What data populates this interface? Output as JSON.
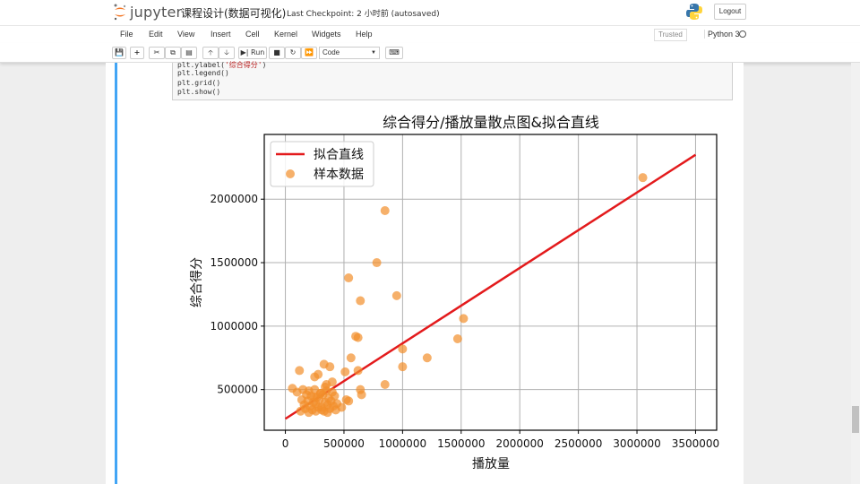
{
  "header": {
    "logo_text": "jupyter",
    "notebook_title": "课程设计(数据可视化)",
    "checkpoint": "Last Checkpoint: 2 小时前  (autosaved)",
    "logout_label": "Logout"
  },
  "menu": {
    "items": [
      "File",
      "Edit",
      "View",
      "Insert",
      "Cell",
      "Kernel",
      "Widgets",
      "Help"
    ],
    "trusted_label": "Trusted",
    "kernel_name": "Python 3"
  },
  "toolbar": {
    "run_label": "Run",
    "cell_type": "Code"
  },
  "code": {
    "line1_prefix": "plt.ylabel(",
    "line1_arg": "'综合得分'",
    "line1_suffix": ")",
    "line2": "plt.legend()",
    "line3": "plt.grid()",
    "line4": "plt.show()"
  },
  "colors": {
    "fit_line": "#e31a1c",
    "scatter": "#f28e2b",
    "cell_bar": "#42a5f5"
  },
  "chart_data": {
    "type": "scatter",
    "title": "综合得分/播放量散点图&拟合直线",
    "xlabel": "播放量",
    "ylabel": "综合得分",
    "xlim": [
      -180000,
      3680000
    ],
    "ylim": [
      180000,
      2510000
    ],
    "xticks": [
      0,
      500000,
      1000000,
      1500000,
      2000000,
      2500000,
      3000000,
      3500000
    ],
    "yticks": [
      500000,
      1000000,
      1500000,
      2000000
    ],
    "grid": true,
    "legend_position": "top-left",
    "series": [
      {
        "name": "拟合直线",
        "kind": "line",
        "x": [
          0,
          3500000
        ],
        "y": [
          270000,
          2350000
        ]
      },
      {
        "name": "样本数据",
        "kind": "scatter",
        "x": [
          3050000,
          850000,
          780000,
          540000,
          640000,
          950000,
          1520000,
          1470000,
          620000,
          600000,
          1000000,
          1210000,
          1000000,
          540000,
          650000,
          330000,
          380000,
          120000,
          620000,
          510000,
          280000,
          250000,
          850000,
          640000,
          400000,
          560000,
          340000,
          60000,
          100000,
          150000,
          200000,
          250000,
          300000,
          350000,
          400000,
          180000,
          220000,
          270000,
          320000,
          370000,
          420000,
          140000,
          190000,
          240000,
          290000,
          340000,
          390000,
          440000,
          160000,
          210000,
          260000,
          310000,
          360000,
          410000,
          170000,
          230000,
          280000,
          330000,
          380000,
          430000,
          130000,
          200000,
          260000,
          310000,
          360000,
          480000,
          520000,
          350000,
          300000,
          250000
        ],
        "y": [
          2170000,
          1910000,
          1500000,
          1380000,
          1200000,
          1240000,
          1060000,
          900000,
          910000,
          920000,
          820000,
          750000,
          680000,
          410000,
          460000,
          700000,
          680000,
          650000,
          650000,
          640000,
          620000,
          600000,
          540000,
          500000,
          560000,
          750000,
          520000,
          510000,
          480000,
          500000,
          490000,
          500000,
          470000,
          490000,
          480000,
          460000,
          450000,
          440000,
          460000,
          430000,
          450000,
          420000,
          410000,
          400000,
          420000,
          400000,
          410000,
          390000,
          380000,
          370000,
          390000,
          360000,
          380000,
          370000,
          350000,
          340000,
          360000,
          330000,
          350000,
          340000,
          330000,
          320000,
          330000,
          340000,
          320000,
          360000,
          420000,
          540000,
          470000,
          440000
        ]
      }
    ]
  }
}
